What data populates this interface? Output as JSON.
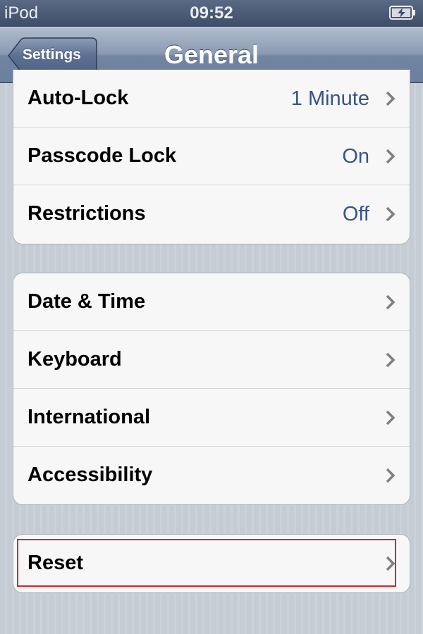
{
  "status_bar": {
    "carrier": "iPod",
    "time": "09:52",
    "battery_icon": "battery-charging-icon"
  },
  "nav": {
    "back_label": "Settings",
    "title": "General"
  },
  "group1": {
    "rows": [
      {
        "label": "Auto-Lock",
        "value": "1 Minute"
      },
      {
        "label": "Passcode Lock",
        "value": "On"
      },
      {
        "label": "Restrictions",
        "value": "Off"
      }
    ]
  },
  "group2": {
    "rows": [
      {
        "label": "Date & Time"
      },
      {
        "label": "Keyboard"
      },
      {
        "label": "International"
      },
      {
        "label": "Accessibility"
      }
    ]
  },
  "group3": {
    "rows": [
      {
        "label": "Reset"
      }
    ]
  },
  "colors": {
    "value_text": "#385487",
    "highlight": "#e0202a",
    "nav_bar": "#7284a0"
  }
}
